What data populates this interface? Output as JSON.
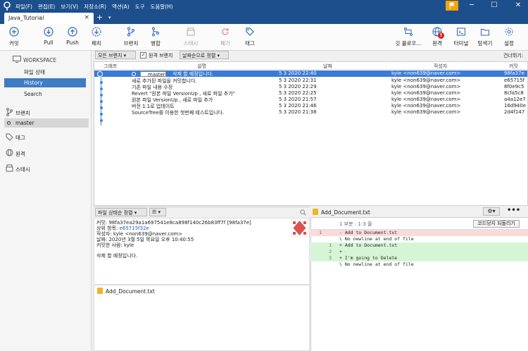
{
  "titlebar": {
    "menu": [
      "파일(F)",
      "편집(E)",
      "보기(V)",
      "저장소(R)",
      "액션(A)",
      "도구",
      "도움말(H)"
    ]
  },
  "tab": {
    "title": "Java_Tutorial",
    "close": "×",
    "new": "+",
    "dropdown": "▾"
  },
  "toolbar": {
    "commit": "커밋",
    "pull": "Pull",
    "push": "Push",
    "fetch": "페치",
    "branch": "브랜치",
    "merge": "병합",
    "stash": "스태시",
    "discard": "폐기",
    "tag": "태그",
    "gitflow": "깃 플로우...",
    "remote": "원격",
    "terminal": "터미널",
    "explorer": "탐색기",
    "settings": "설정",
    "remote_badge": "!"
  },
  "sidebar": {
    "workspace": "WORKSPACE",
    "file_status": "파일 상태",
    "history": "History",
    "search": "Search",
    "branches": "브랜치",
    "master": "master",
    "tags": "태그",
    "remotes": "원격",
    "stashes": "스태시"
  },
  "filterbar": {
    "all_branches": "모든 브랜치",
    "show_remote": "원격 브랜치",
    "date_order": "날짜순으로 정렬",
    "jump_to": "건너뛰기:"
  },
  "commit_table": {
    "headers": {
      "graph": "그래프",
      "description": "설명",
      "date": "날짜",
      "author": "작성자",
      "commit": "커밋"
    },
    "tag": "master",
    "rows": [
      {
        "desc": "삭제 할 예정입니다.",
        "date": "5 3 2020 22:40",
        "author": "kyle <non639@naver.com>",
        "hash": "98fa37e"
      },
      {
        "desc": "새로 추가된 파일을 커밋합니다.",
        "date": "5 3 2020 22:31",
        "author": "kyle <non639@naver.com>",
        "hash": "e65715f"
      },
      {
        "desc": "기존 파일 내용 수정",
        "date": "5 3 2020 22:29",
        "author": "kyle <non639@naver.com>",
        "hash": "8f0e9c5"
      },
      {
        "desc": "Revert \"원본 파일 VersionUp , 새로 파일 추가\"",
        "date": "5 3 2020 22:25",
        "author": "kyle <non639@naver.com>",
        "hash": "8cfa5c8"
      },
      {
        "desc": "원본 파일 VersionUp , 새로 파일 추가",
        "date": "5 3 2020 21:57",
        "author": "kyle <non639@naver.com>",
        "hash": "a4a12e7"
      },
      {
        "desc": "버전 1.1로 업데이트",
        "date": "5 3 2020 21:46",
        "author": "kyle <non639@naver.com>",
        "hash": "16d940e"
      },
      {
        "desc": "SourceTree를 이용한 첫번째 테스트입니다.",
        "date": "5 3 2020 21:38",
        "author": "kyle <non639@naver.com>",
        "hash": "2d4f147"
      }
    ]
  },
  "details": {
    "sort": "파일 상태순 정렬",
    "view": "☰",
    "commit_line": "커밋: 98fa37ea29a1a697541e8ca898f140c26b83ff7f [98fa37e]",
    "parent_label": "상위 항목: ",
    "parent": "e65715f32e",
    "author": "작성자: kyle <non639@naver.com>",
    "date": "날짜: 2020년 3월 5일 목요일 오후 10:40:55",
    "committer": "커밋한 사람: kyle",
    "message": "삭제 할 예정입니다.",
    "file": "Add_Document.txt"
  },
  "diff": {
    "file": "Add_Document.txt",
    "hunk": "1 부분 : 1-3 줄",
    "revert": "코드덩지 되돌리기",
    "lines": [
      {
        "n1": "1",
        "n2": "",
        "text": "- Add to Document.txt",
        "kind": "rm"
      },
      {
        "n1": "",
        "n2": "",
        "text": "\\  No newline at end of file",
        "kind": ""
      },
      {
        "n1": "",
        "n2": "1",
        "text": "+ Add to Document.txt",
        "kind": "ad"
      },
      {
        "n1": "",
        "n2": "2",
        "text": "+",
        "kind": "ad"
      },
      {
        "n1": "",
        "n2": "3",
        "text": "+ I'm going to Delete",
        "kind": "ad"
      },
      {
        "n1": "",
        "n2": "",
        "text": "\\  No newline at end of file",
        "kind": ""
      }
    ]
  },
  "colors": {
    "titlebar": "#1c4f8c",
    "selection": "#3a7bd5",
    "accent": "#f5a40a"
  }
}
